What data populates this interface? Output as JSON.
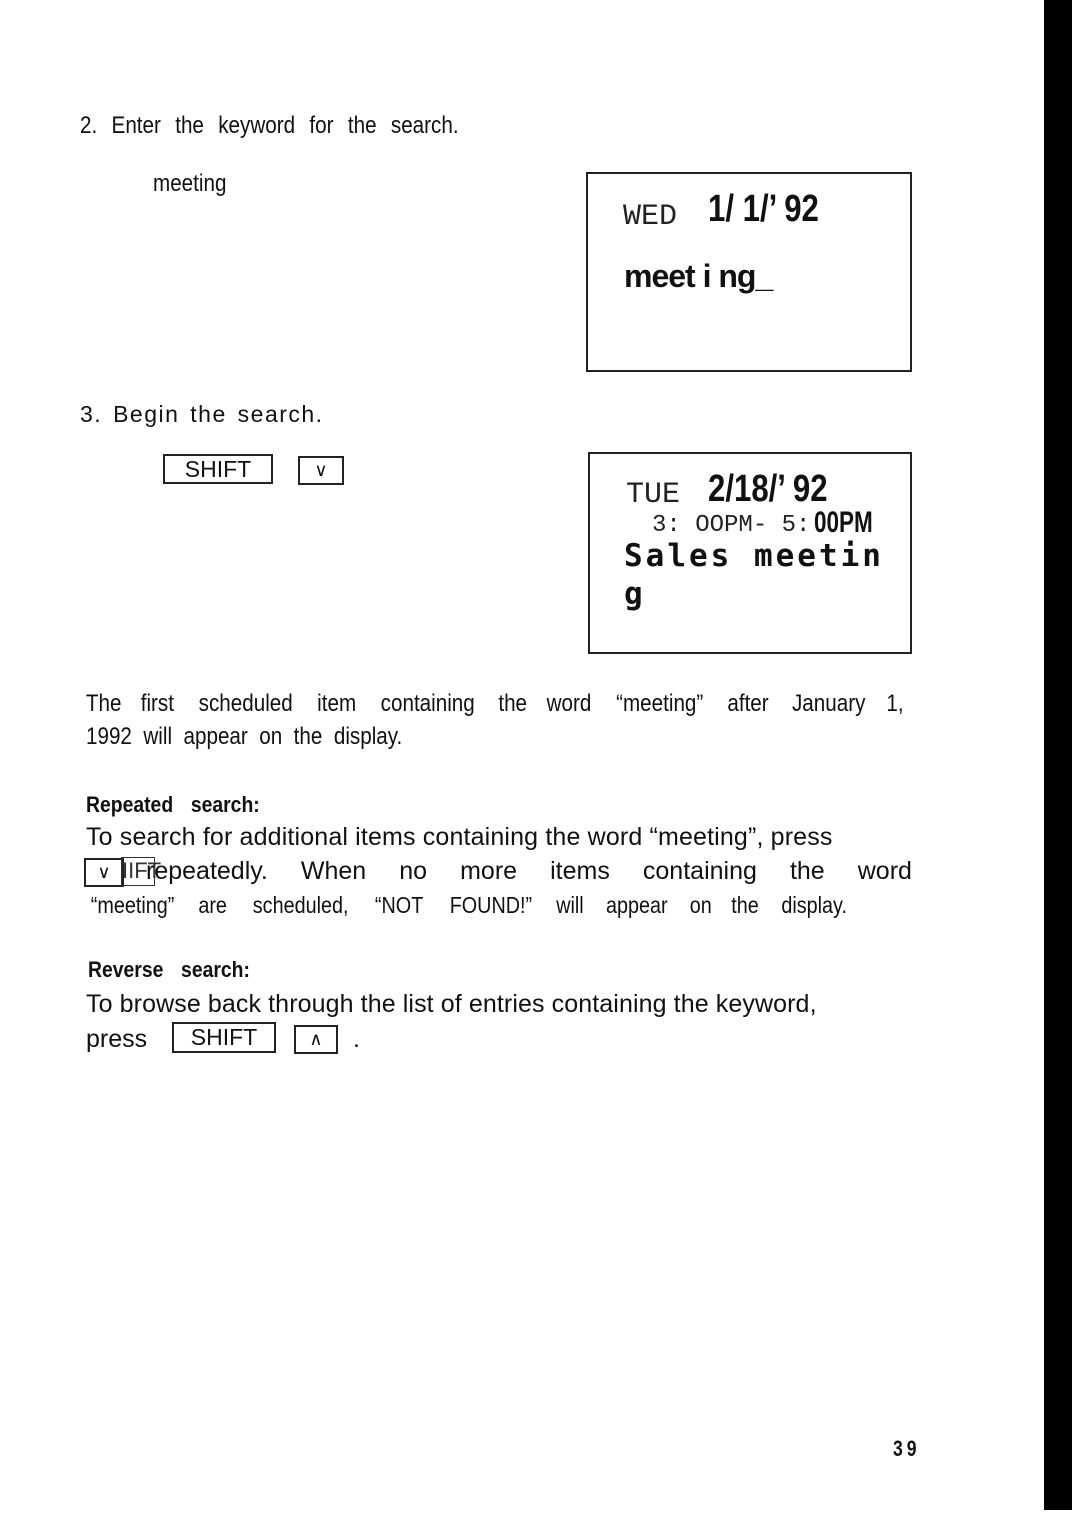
{
  "steps": {
    "step2": {
      "text": "2. Enter the keyword for the search.",
      "input_keyword": "meeting",
      "display": {
        "day": "WED",
        "date": "1/ 1/’ 92",
        "entry": "meet i ng_"
      }
    },
    "step3": {
      "text": "3. Begin the search.",
      "keys": [
        "SHIFT",
        "∨"
      ],
      "display": {
        "day": "TUE",
        "date": "2/18/’ 92",
        "time_start": "3: OOPM- 5:",
        "time_end": "00PM",
        "entry_line1": "Sales meetin",
        "entry_line2": "g"
      }
    }
  },
  "description": {
    "line1_words": [
      "The",
      "first",
      "scheduled",
      "item",
      "containing",
      "the",
      "word",
      "“meeting”",
      "after",
      "January",
      "1,"
    ],
    "line2": "1992  will  appear  on  the  display."
  },
  "repeated_search": {
    "heading": "Repeated search:",
    "line1": "To search for additional items containing the word “meeting”, press",
    "key_down": "∨",
    "key_overprint": "IIFT",
    "line2_words": [
      "repeatedly.",
      "When",
      "no",
      "more",
      "items",
      "containing",
      "the",
      "word"
    ],
    "line3_words": [
      "“meeting”",
      "are",
      "scheduled,",
      "“NOT",
      "FOUND!”",
      "will",
      "appear",
      "on",
      "the",
      "display."
    ]
  },
  "reverse_search": {
    "heading": "Reverse search:",
    "line1": "To browse back through the list of entries containing the keyword,",
    "press_label": "press",
    "key_shift": "SHIFT",
    "key_up": "∧",
    "trailing": "."
  },
  "footer": {
    "page_number": "39"
  }
}
